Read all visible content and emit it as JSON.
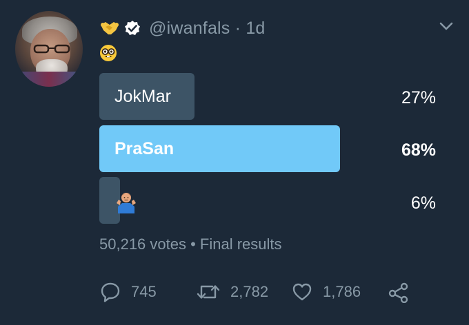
{
  "tweet": {
    "handle": "@iwanfals",
    "time": "1d",
    "handle_line": "@iwanfals · 1d",
    "badge_icons": [
      "handshake-icon",
      "verified-badge-icon"
    ],
    "text_emoji": "nerd-face-emoji"
  },
  "poll": {
    "options": [
      {
        "label": "JokMar",
        "percent_text": "27%",
        "percent": 27,
        "winner": false
      },
      {
        "label": "PraSan",
        "percent_text": "68%",
        "percent": 68,
        "winner": true
      },
      {
        "label": "",
        "emoji": "person-shrugging-emoji",
        "percent_text": "6%",
        "percent": 6,
        "winner": false
      }
    ],
    "summary": "50,216 votes • Final results"
  },
  "actions": {
    "replies": "745",
    "retweets": "2,782",
    "likes": "1,786"
  },
  "colors": {
    "background": "#1c2938",
    "bar": "#3d5466",
    "winner_bar": "#71c9f8",
    "muted_text": "#8899a6"
  }
}
